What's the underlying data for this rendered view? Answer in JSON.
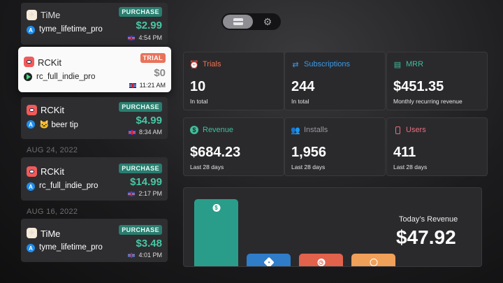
{
  "transactions": [
    {
      "app": "TiMe",
      "product": "tyme_lifetime_pro",
      "badge": "PURCHASE",
      "price": "$2.99",
      "time": "4:54 PM"
    },
    {
      "app": "RCKit",
      "product": "rc_full_indie_pro",
      "badge": "TRIAL",
      "price": "$0",
      "time": "11:21 AM"
    },
    {
      "app": "RCKit",
      "product": "🐱 beer tip",
      "badge": "PURCHASE",
      "price": "$4.99",
      "time": "8:34 AM"
    },
    {
      "app": "RCKit",
      "product": "rc_full_indie_pro",
      "badge": "PURCHASE",
      "price": "$14.99",
      "time": "2:17 PM"
    },
    {
      "app": "TiMe",
      "product": "tyme_lifetime_pro",
      "badge": "PURCHASE",
      "price": "$3.48",
      "time": "4:01 PM"
    }
  ],
  "date_headers": [
    "AUG 24, 2022",
    "AUG 16, 2022"
  ],
  "stats": [
    {
      "label": "Trials",
      "value": "10",
      "sub": "In total",
      "color": "#f0734f",
      "icon": "alarm-clock-icon"
    },
    {
      "label": "Subscriptions",
      "value": "244",
      "sub": "In total",
      "color": "#3a9be8",
      "icon": "repeat-icon"
    },
    {
      "label": "MRR",
      "value": "$451.35",
      "sub": "Monthly recurring revenue",
      "color": "#3fbf9b",
      "icon": "chart-icon"
    },
    {
      "label": "Revenue",
      "value": "$684.23",
      "sub": "Last 28 days",
      "color": "#3fbf9b",
      "icon": "dollar-icon"
    },
    {
      "label": "Installs",
      "value": "1,956",
      "sub": "Last 28 days",
      "color": "#9a9a9e",
      "icon": "people-icon"
    },
    {
      "label": "Users",
      "value": "411",
      "sub": "Last 28 days",
      "color": "#e8707f",
      "icon": "phone-icon"
    }
  ],
  "today": {
    "label": "Today’s Revenue",
    "value": "$47.92"
  },
  "revenue_bars": [
    {
      "kind": "purchases",
      "color": "#2a9d8a",
      "icon": "dollar-icon",
      "level": 1.0
    },
    {
      "kind": "tags",
      "color": "#2f7cc9",
      "icon": "tag-icon",
      "level": 0.2
    },
    {
      "kind": "trials",
      "color": "#e2624c",
      "icon": "alarm-clock-icon",
      "level": 0.2
    },
    {
      "kind": "renewals",
      "color": "#f0a058",
      "icon": "renew-icon",
      "level": 0.2
    }
  ]
}
